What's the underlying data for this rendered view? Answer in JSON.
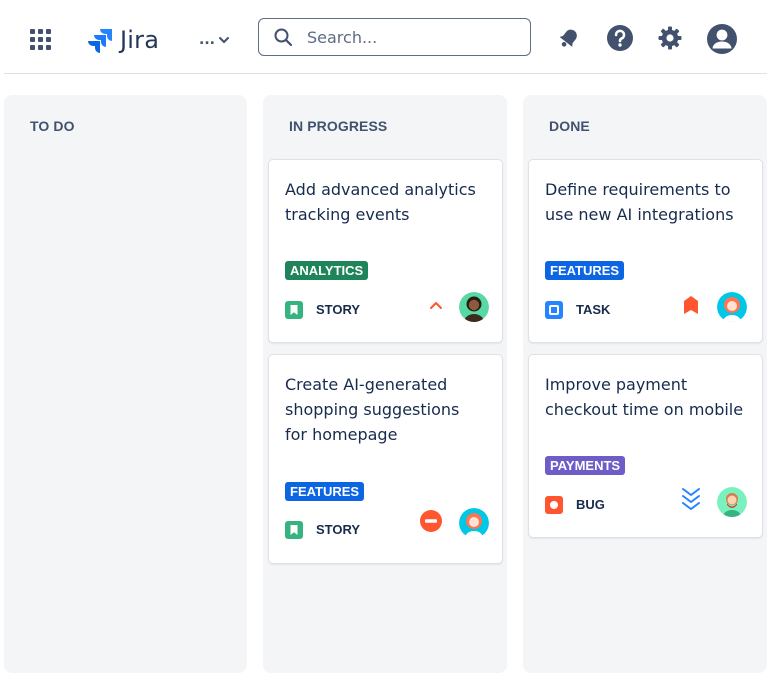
{
  "app": {
    "name": "Jira",
    "more_label": "...",
    "search": {
      "placeholder": "Search..."
    }
  },
  "columns": [
    {
      "title": "TO DO",
      "cards": []
    },
    {
      "title": "IN PROGRESS",
      "cards": [
        {
          "title": "Add advanced analytics tracking events",
          "label": "ANALYTICS",
          "label_color": "#1f845a",
          "type": "STORY",
          "type_icon": "story-icon",
          "priority_icon": "priority-medium-icon"
        },
        {
          "title": "Create AI-generated shopping suggestions for homepage",
          "label": "FEATURES",
          "label_color": "#0c66e4",
          "type": "STORY",
          "type_icon": "story-icon",
          "priority_icon": "blocker-icon"
        }
      ]
    },
    {
      "title": "DONE",
      "cards": [
        {
          "title": "Define requirements to use new AI integrations",
          "label": "FEATURES",
          "label_color": "#0c66e4",
          "type": "TASK",
          "type_icon": "task-icon",
          "priority_icon": "priority-flag-icon"
        },
        {
          "title": "Improve payment checkout time on mobile",
          "label": "PAYMENTS",
          "label_color": "#6e5dc6",
          "type": "BUG",
          "type_icon": "bug-icon",
          "priority_icon": "priority-lowest-icon"
        }
      ]
    }
  ],
  "colors": {
    "story": "#36b37e",
    "task": "#2684ff",
    "bug": "#ff5630",
    "priority_high": "#ff5630",
    "priority_low": "#2684ff",
    "accent": "#0c66e4"
  }
}
